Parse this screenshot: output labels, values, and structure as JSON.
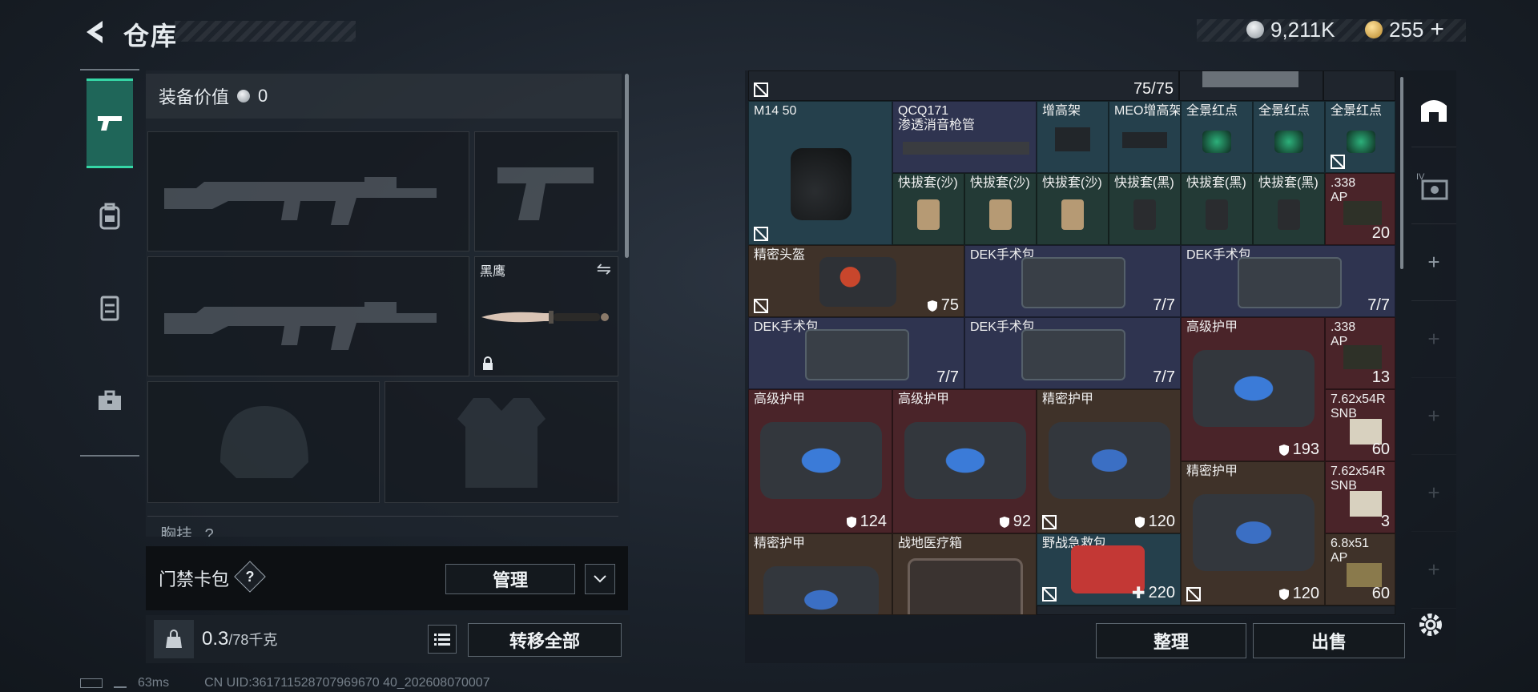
{
  "header": {
    "title": "仓库",
    "currency_silver": "9,211K",
    "currency_gold": "255",
    "currency_plus": "+"
  },
  "left_tabs": [
    "pistol-icon",
    "backpack-icon",
    "vest-icon",
    "toolbox-icon"
  ],
  "equipment": {
    "value_label": "装备价值",
    "value": "0",
    "knife_label": "黑鹰",
    "chest_label": "胸挂",
    "chest_help": "?"
  },
  "keycard": {
    "label": "门禁卡包",
    "help": "?",
    "manage_label": "管理"
  },
  "weight": {
    "current": "0.3",
    "max": "/78千克",
    "transfer_all_label": "转移全部"
  },
  "storage": {
    "top_count": "75/75",
    "items": {
      "m14": {
        "name": "M14 50"
      },
      "qcq": {
        "name": "QCQ171",
        "sub": "渗透消音枪管"
      },
      "riser": {
        "name": "增高架"
      },
      "meo": {
        "name": "MEO增高架"
      },
      "holo1": {
        "name": "全景红点"
      },
      "holo2": {
        "name": "全景红点"
      },
      "holo3": {
        "name": "全景红点"
      },
      "qd1": {
        "name": "快拔套(沙)"
      },
      "qd2": {
        "name": "快拔套(沙)"
      },
      "qd3": {
        "name": "快拔套(沙)"
      },
      "qd4": {
        "name": "快拔套(黑)"
      },
      "qd5": {
        "name": "快拔套(黑)"
      },
      "qd6": {
        "name": "快拔套(黑)"
      },
      "ammo338a": {
        "name": ".338",
        "sub": "AP",
        "qty": "20"
      },
      "helmet": {
        "name": "精密头盔",
        "qty": "75"
      },
      "dek1": {
        "name": "DEK手术包",
        "qty": "7/7"
      },
      "dek2": {
        "name": "DEK手术包",
        "qty": "7/7"
      },
      "dek3": {
        "name": "DEK手术包",
        "qty": "7/7"
      },
      "dek4": {
        "name": "DEK手术包",
        "qty": "7/7"
      },
      "armor_big": {
        "name": "高级护甲",
        "qty": "193"
      },
      "ammo338b": {
        "name": ".338",
        "sub": "AP",
        "qty": "13"
      },
      "armor1": {
        "name": "高级护甲",
        "qty": "124"
      },
      "armor2": {
        "name": "高级护甲",
        "qty": "92"
      },
      "armor3": {
        "name": "精密护甲",
        "qty": "120"
      },
      "ammo762a": {
        "name": "7.62x54R",
        "sub": "SNB",
        "qty": "60"
      },
      "armor4": {
        "name": "精密护甲",
        "qty": "120"
      },
      "ammo762b": {
        "name": "7.62x54R",
        "sub": "SNB",
        "qty": "3"
      },
      "armor5": {
        "name": "精密护甲"
      },
      "medbox": {
        "name": "战地医疗箱"
      },
      "firstaid": {
        "name": "野战急救包",
        "qty": "220"
      },
      "ammo68": {
        "name": "6.8x51",
        "sub": "AP",
        "qty": "60"
      }
    },
    "sort_label": "整理",
    "sell_label": "出售"
  },
  "right_menu": [
    "home-icon",
    "armor-iv-icon",
    "+",
    "+",
    "+",
    "+",
    "+"
  ],
  "status": {
    "ping": "63ms",
    "uid": "CN UID:361711528707969670 40_202608070007"
  },
  "colors": {
    "accent": "#35d6a6",
    "rarity_purple": "#2f3450",
    "rarity_red": "#4a2429",
    "rarity_gold": "#3f3229",
    "rarity_blue": "#25404c",
    "rarity_green": "#233a36"
  }
}
